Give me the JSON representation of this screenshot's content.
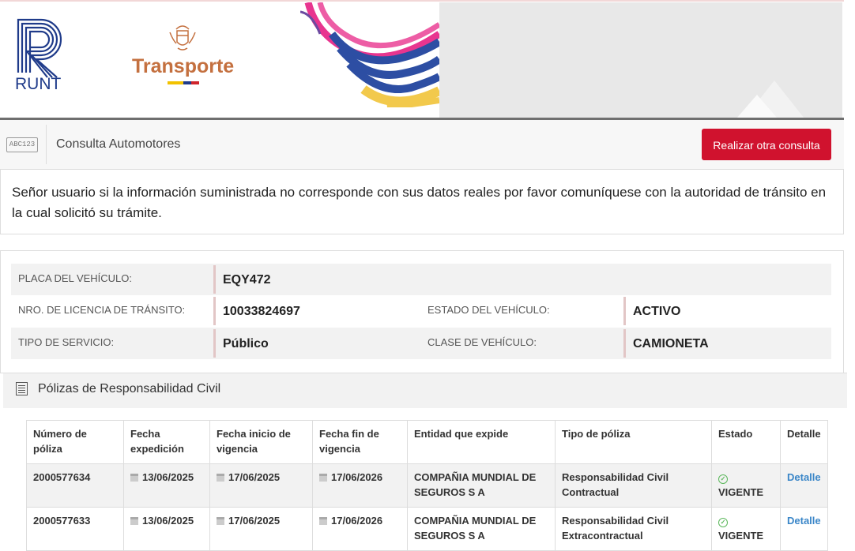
{
  "header": {
    "runt_label": "RUNT",
    "transporte_label": "Transporte"
  },
  "bar": {
    "badge": "ABC123",
    "title": "Consulta Automotores",
    "button_label": "Realizar otra consulta"
  },
  "notice": {
    "text": "Señor usuario si la información suministrada no corresponde con sus datos reales por favor comuníquese con la autoridad de tránsito en la cual solicitó su trámite."
  },
  "vehicle": {
    "placa_label": "PLACA DEL VEHÍCULO:",
    "placa_value": "EQY472",
    "licencia_label": "NRO. DE LICENCIA DE TRÁNSITO:",
    "licencia_value": "10033824697",
    "estado_label": "ESTADO DEL VEHÍCULO:",
    "estado_value": "ACTIVO",
    "servicio_label": "TIPO DE SERVICIO:",
    "servicio_value": "Público",
    "clase_label": "CLASE DE VEHÍCULO:",
    "clase_value": "CAMIONETA"
  },
  "polizas": {
    "title": "Pólizas de Responsabilidad Civil",
    "columns": [
      "Número de póliza",
      "Fecha expedición",
      "Fecha inicio de vigencia",
      "Fecha fin de vigencia",
      "Entidad que expide",
      "Tipo de póliza",
      "Estado",
      "Detalle"
    ],
    "rows": [
      {
        "numero": "2000577634",
        "expedicion": "13/06/2025",
        "inicio": "17/06/2025",
        "fin": "17/06/2026",
        "entidad": "COMPAÑIA MUNDIAL DE SEGUROS S A",
        "tipo": "Responsabilidad Civil Contractual",
        "estado": "VIGENTE",
        "detalle": "Detalle"
      },
      {
        "numero": "2000577633",
        "expedicion": "13/06/2025",
        "inicio": "17/06/2025",
        "fin": "17/06/2026",
        "entidad": "COMPAÑIA MUNDIAL DE SEGUROS S A",
        "tipo": "Responsabilidad Civil Extracontractual",
        "estado": "VIGENTE",
        "detalle": "Detalle"
      }
    ]
  }
}
